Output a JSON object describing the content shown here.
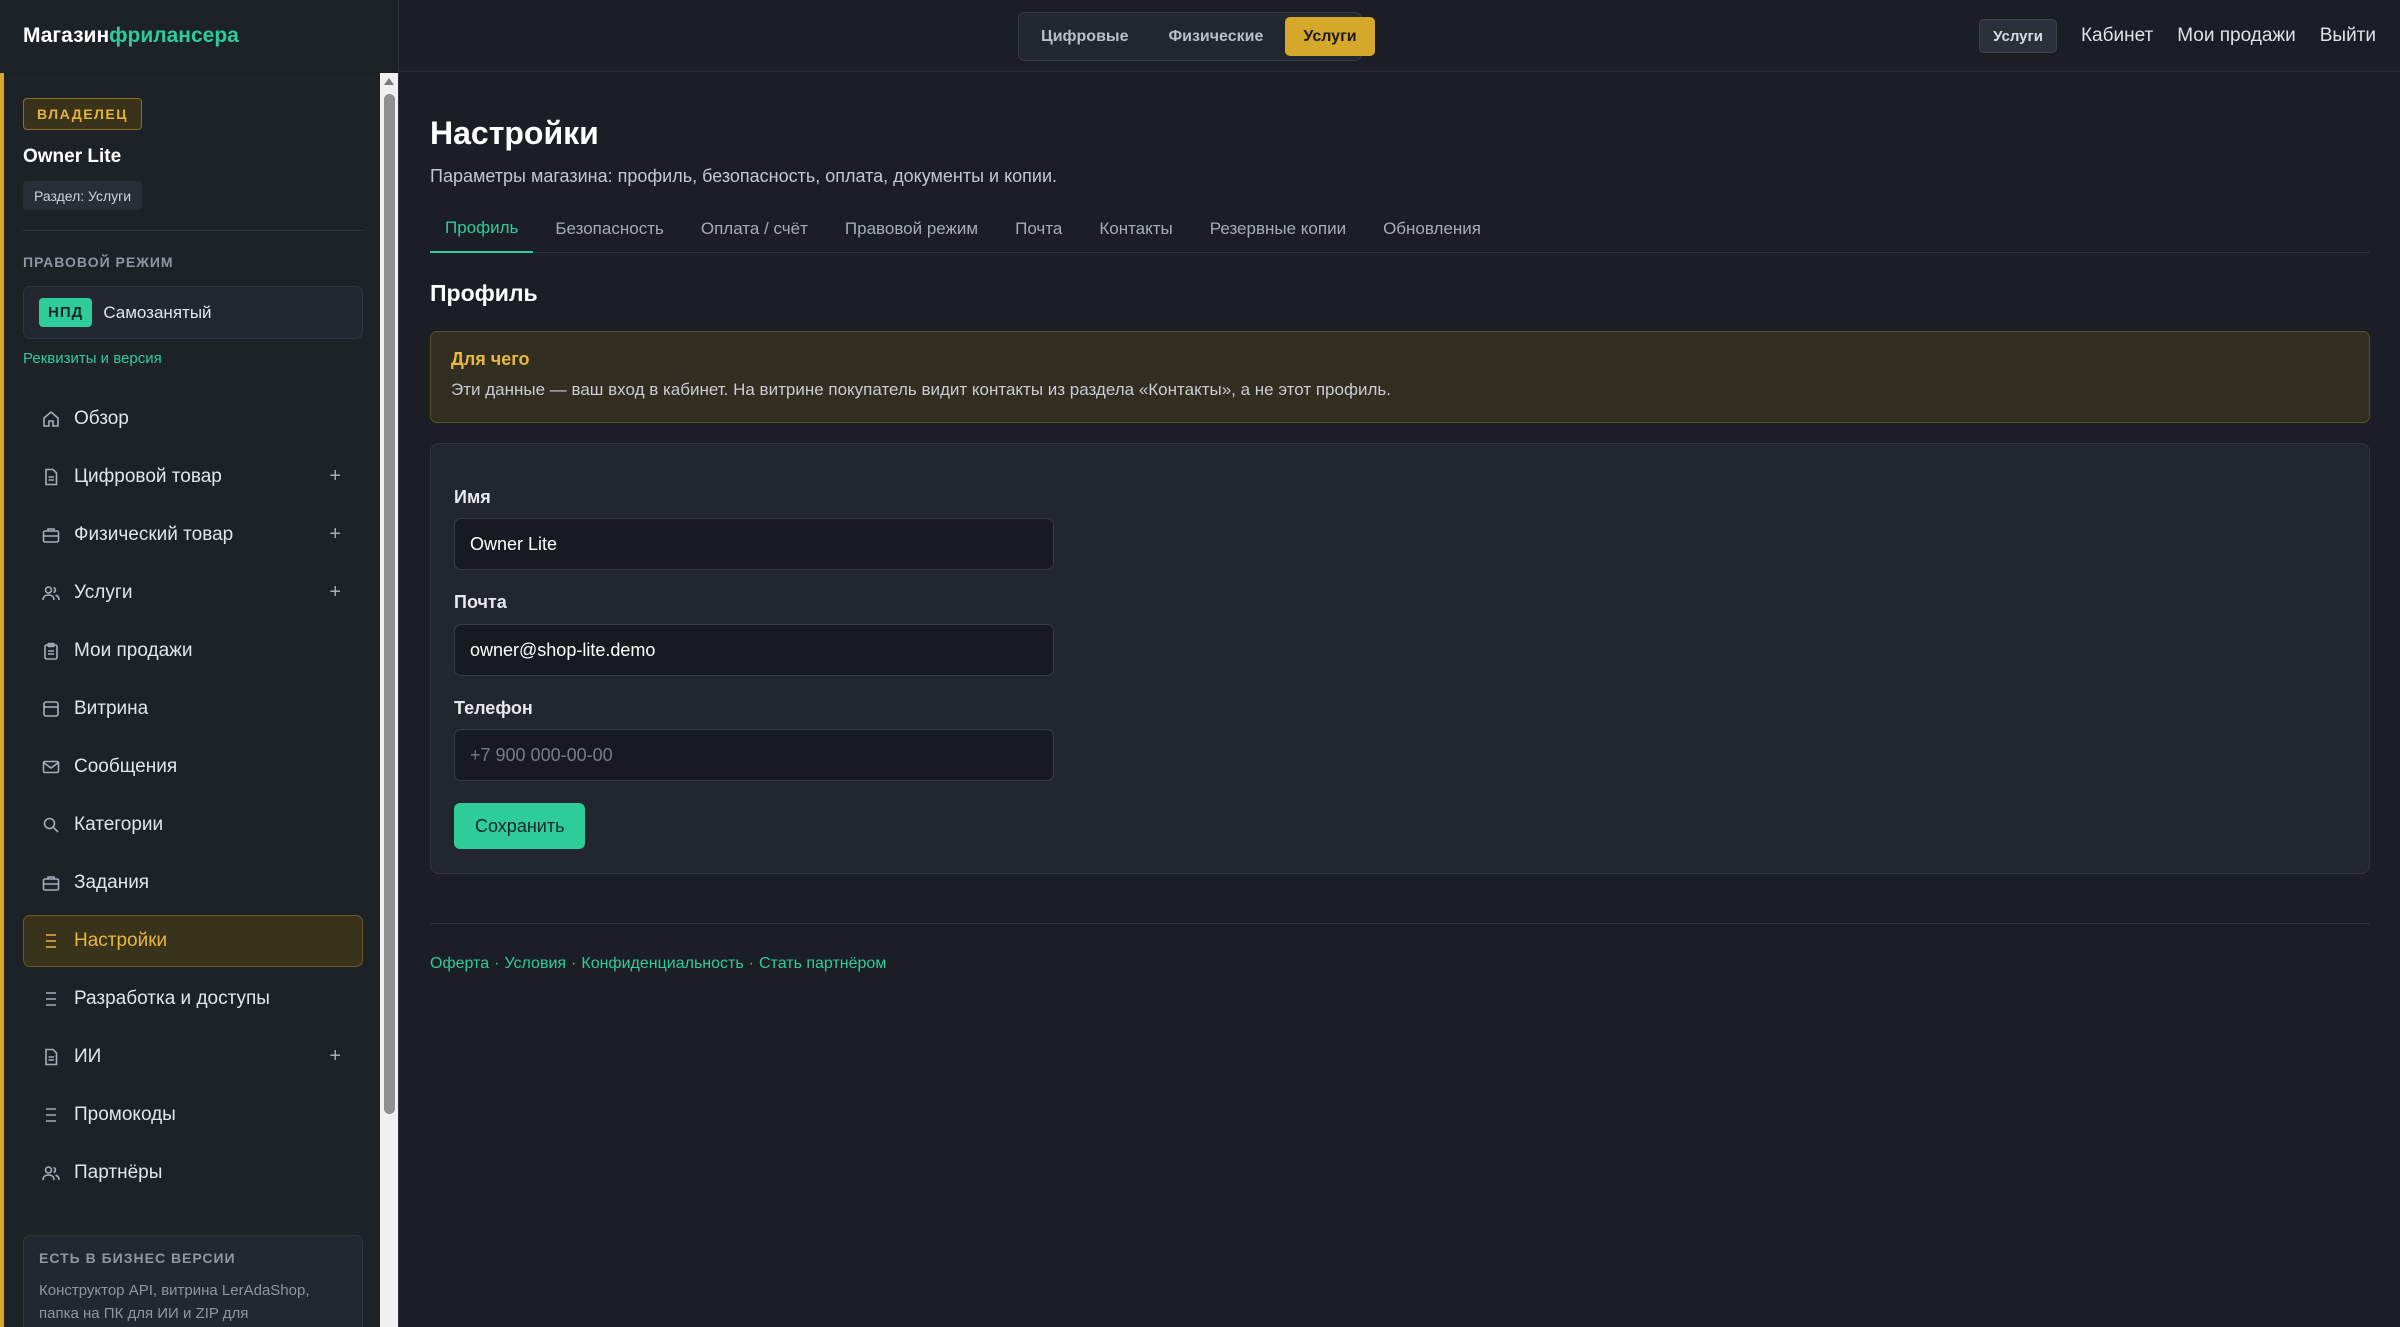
{
  "brand": {
    "part1": "Магазин",
    "part2": "фрилансера"
  },
  "segments": [
    "Цифровые",
    "Физические",
    "Услуги"
  ],
  "segment_active": "Услуги",
  "topnav": {
    "chip": "Услуги",
    "cabinet": "Кабинет",
    "sales": "Мои продажи",
    "logout": "Выйти"
  },
  "sidebar": {
    "role_badge": "ВЛАДЕЛЕЦ",
    "owner_name": "Owner Lite",
    "section_chip": "Раздел: Услуги",
    "legal_title": "ПРАВОВОЙ РЕЖИМ",
    "legal_badge": "НПД",
    "legal_mode": "Самозанятый",
    "legal_link": "Реквизиты и версия",
    "items": [
      {
        "label": "Обзор",
        "icon": "home-icon"
      },
      {
        "label": "Цифровой товар",
        "icon": "document-icon",
        "plus": "+"
      },
      {
        "label": "Физический товар",
        "icon": "briefcase-icon",
        "plus": "+"
      },
      {
        "label": "Услуги",
        "icon": "users-icon",
        "plus": "+"
      },
      {
        "label": "Мои продажи",
        "icon": "clipboard-icon"
      },
      {
        "label": "Витрина",
        "icon": "storefront-icon"
      },
      {
        "label": "Сообщения",
        "icon": "mail-icon"
      },
      {
        "label": "Категории",
        "icon": "search-icon"
      },
      {
        "label": "Задания",
        "icon": "briefcase-icon"
      },
      {
        "label": "Настройки",
        "icon": "list-icon",
        "active": true
      },
      {
        "label": "Разработка и доступы",
        "icon": "list-icon"
      },
      {
        "label": "ИИ",
        "icon": "document-icon",
        "plus": "+"
      },
      {
        "label": "Промокоды",
        "icon": "list-icon"
      },
      {
        "label": "Партнёры",
        "icon": "users-icon"
      }
    ],
    "biz_title": "ЕСТЬ В БИЗНЕС ВЕРСИИ",
    "biz_text_line1": "Конструктор API, витрина LerAdaShop,",
    "biz_text_line2": "папка на ПК для ИИ и ZIP для"
  },
  "main": {
    "title": "Настройки",
    "subtitle": "Параметры магазина: профиль, безопасность, оплата, документы и копии.",
    "tabs": [
      "Профиль",
      "Безопасность",
      "Оплата / счёт",
      "Правовой режим",
      "Почта",
      "Контакты",
      "Резервные копии",
      "Обновления"
    ],
    "active_tab": "Профиль",
    "section_title": "Профиль",
    "notice_title": "Для чего",
    "notice_text": "Эти данные — ваш вход в кабинет. На витрине покупатель видит контакты из раздела «Контакты», а не этот профиль.",
    "form": {
      "name_label": "Имя",
      "name_value": "Owner Lite",
      "email_label": "Почта",
      "email_value": "owner@shop-lite.demo",
      "phone_label": "Телефон",
      "phone_placeholder": "+7 900 000-00-00",
      "phone_value": "",
      "save_label": "Сохранить"
    },
    "footer": {
      "offer": "Оферта",
      "terms": "Условия",
      "privacy": "Конфиденциальность",
      "partner": "Стать партнёром",
      "sep": "·"
    }
  },
  "colors": {
    "accent": "#2ecc9a",
    "gold": "#d6a82a",
    "bg": "#1b1e25",
    "sidebar": "#1d2227"
  }
}
